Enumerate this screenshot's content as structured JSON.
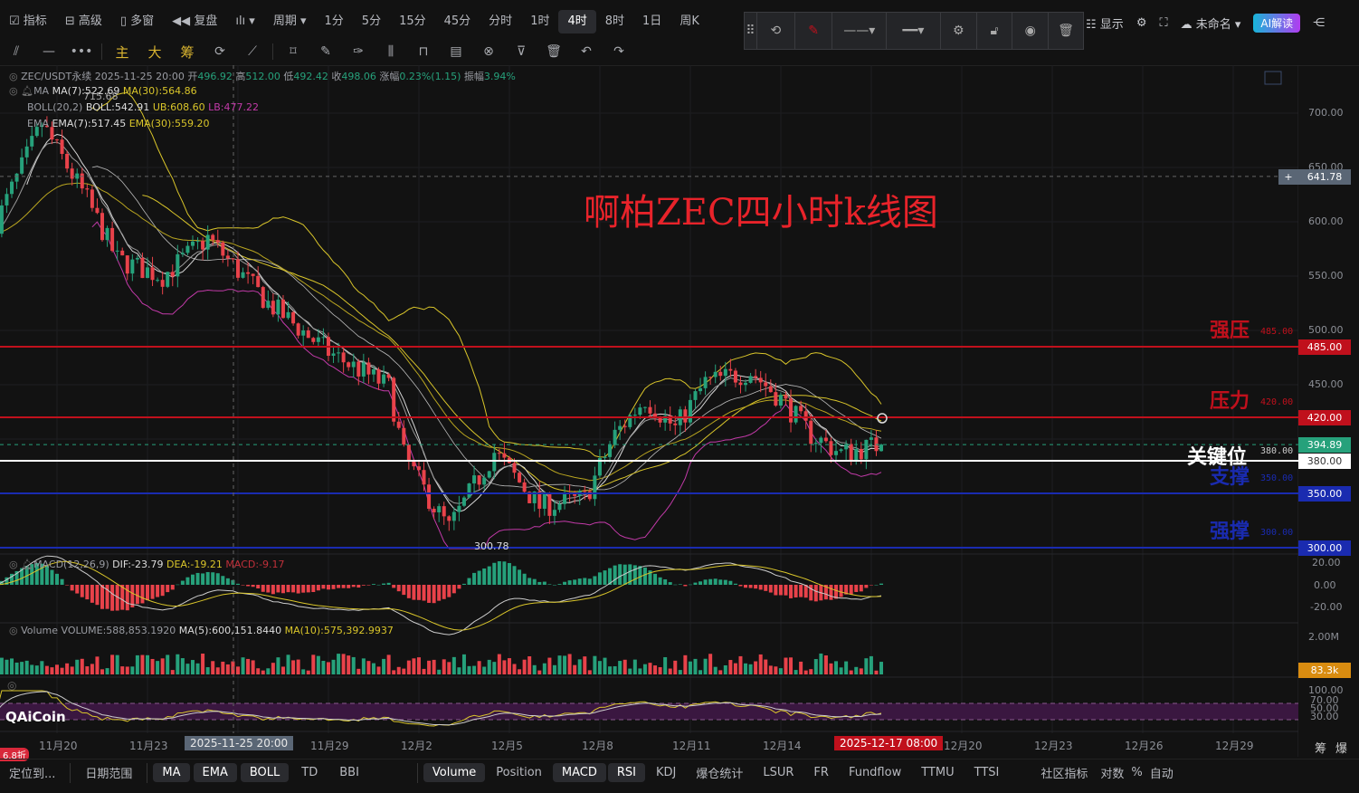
{
  "toolbar": {
    "items": [
      "指标",
      "高级",
      "多窗",
      "复盘",
      "周期",
      "1分",
      "5分",
      "15分",
      "45分",
      "分时",
      "1时",
      "4时",
      "8时",
      "1日",
      "周K"
    ],
    "selected": "4时",
    "icons": [
      "pattern-icon",
      "horizontal-line-icon",
      "dots-icon",
      "主",
      "大",
      "筹",
      "replay-icon",
      "brush-icon",
      "rectangle-icon",
      "ruler-icon",
      "pen-icon",
      "bars-icon",
      "lock-icon",
      "note-icon",
      "magnet-icon",
      "filter-icon",
      "trash-icon",
      "undo-icon",
      "redo-icon"
    ]
  },
  "right_toolbar": {
    "display": "显示",
    "layout": "未命名",
    "ai": "AI解读"
  },
  "legend": {
    "symbol": "ZEC/USDT永续",
    "time": "2025-11-25 20:00",
    "open_l": "开",
    "open": "496.92",
    "high_l": "高",
    "high": "512.00",
    "low_l": "低",
    "low": "492.42",
    "close_l": "收",
    "close": "498.06",
    "chg_l": "涨幅",
    "chg": "0.23%(1.15)",
    "amp_l": "振幅",
    "amp": "3.94%",
    "ma": "MA",
    "ma7": "MA(7):522.69",
    "ma30": "MA(30):564.86",
    "boll": "BOLL(20,2)",
    "bollv": "BOLL:542.91",
    "ub": "UB:608.60",
    "lb": "LB:477.22",
    "ema": "EMA",
    "ema7": "EMA(7):517.45",
    "ema30": "EMA(30):559.20",
    "high_mark": "715.68",
    "low_mark": "300.78"
  },
  "title": "啊柏ZEC四小时k线图",
  "levels": [
    {
      "name": "强压",
      "price": 485,
      "label": "485.00",
      "color": "#c0101c"
    },
    {
      "name": "压力",
      "price": 420,
      "label": "420.00",
      "color": "#c0101c"
    },
    {
      "name": "关键位",
      "price": 380,
      "label": "380.00",
      "color": "#ffffff"
    },
    {
      "name": "支撑",
      "price": 350,
      "label": "350.00",
      "color": "#1a2bb0"
    },
    {
      "name": "强撑",
      "price": 300,
      "label": "300.00",
      "color": "#1a2bb0"
    }
  ],
  "price_axis": [
    "700.00",
    "650.00",
    "600.00",
    "550.00",
    "500.00",
    "450.00"
  ],
  "crosshair_price": "641.78",
  "last_price": "394.89",
  "macd": {
    "label": "MACD(12,26,9)",
    "dif": "DIF:-23.79",
    "dea": "DEA:-19.21",
    "macd": "MACD:-9.17",
    "axis": [
      "20.00",
      "0.00",
      "-20.00"
    ]
  },
  "volume": {
    "label": "Volume",
    "vol": "VOLUME:588,853.1920",
    "ma5": "MA(5):600,151.8440",
    "ma10": "MA(10):575,392.9937",
    "axis": "2.00M",
    "last": "83.3k"
  },
  "rsi": {
    "axis": [
      "100.00",
      "70.00",
      "50.00",
      "30.00"
    ]
  },
  "x_axis": [
    "11月20",
    "11月23",
    "11月29",
    "12月2",
    "12月5",
    "12月8",
    "12月11",
    "12月14",
    "12月20",
    "12月23",
    "12月26",
    "12月29"
  ],
  "cross_time": "2025-11-25 20:00",
  "current_time": "2025-12-17 08:00",
  "x_right": [
    "筹",
    "爆"
  ],
  "discount": "6.8折",
  "brand": "AiCoin",
  "bottom": {
    "locate": "定位到...",
    "range": "日期范围",
    "main": [
      "MA",
      "EMA",
      "BOLL",
      "TD",
      "BBI"
    ],
    "main_on": [
      "MA",
      "EMA",
      "BOLL"
    ],
    "sub": [
      "Volume",
      "Position",
      "MACD",
      "RSI",
      "KDJ",
      "爆仓统计",
      "LSUR",
      "FR",
      "Fundflow",
      "TTMU",
      "TTSI"
    ],
    "sub_on": [
      "Volume",
      "MACD",
      "RSI"
    ],
    "community": "社区指标",
    "log": "对数",
    "pct": "%",
    "auto": "自动"
  },
  "colors": {
    "up": "#26a17b",
    "down": "#e8424a",
    "ma7": "#d8d8d8",
    "ma30": "#d9c52a",
    "ub": "#d9c52a",
    "lb": "#c23aa8",
    "bg": "#121212"
  },
  "chart_data": {
    "type": "candlestick",
    "interval": "4h",
    "ylim": [
      290,
      720
    ],
    "keypoints": [
      [
        "2025-11-18 00:00",
        600
      ],
      [
        "2025-11-19 12:00",
        690
      ],
      [
        "2025-11-21 00:00",
        620
      ],
      [
        "2025-11-22 00:00",
        565
      ],
      [
        "2025-11-23 12:00",
        550
      ],
      [
        "2025-11-25 00:00",
        585
      ],
      [
        "2025-11-27 00:00",
        525
      ],
      [
        "2025-11-29 00:00",
        480
      ],
      [
        "2025-12-01 00:00",
        448
      ],
      [
        "2025-12-01 12:00",
        385
      ],
      [
        "2025-12-02 12:00",
        338
      ],
      [
        "2025-12-03 00:00",
        318
      ],
      [
        "2025-12-04 12:00",
        388
      ],
      [
        "2025-12-06 00:00",
        338
      ],
      [
        "2025-12-07 12:00",
        345
      ],
      [
        "2025-12-08 12:00",
        404
      ],
      [
        "2025-12-09 12:00",
        437
      ],
      [
        "2025-12-10 12:00",
        410
      ],
      [
        "2025-12-11 12:00",
        452
      ],
      [
        "2025-12-13 00:00",
        462
      ],
      [
        "2025-12-14 00:00",
        437
      ],
      [
        "2025-12-15 00:00",
        404
      ],
      [
        "2025-12-16 00:00",
        387
      ],
      [
        "2025-12-17 08:00",
        394.89
      ]
    ]
  }
}
